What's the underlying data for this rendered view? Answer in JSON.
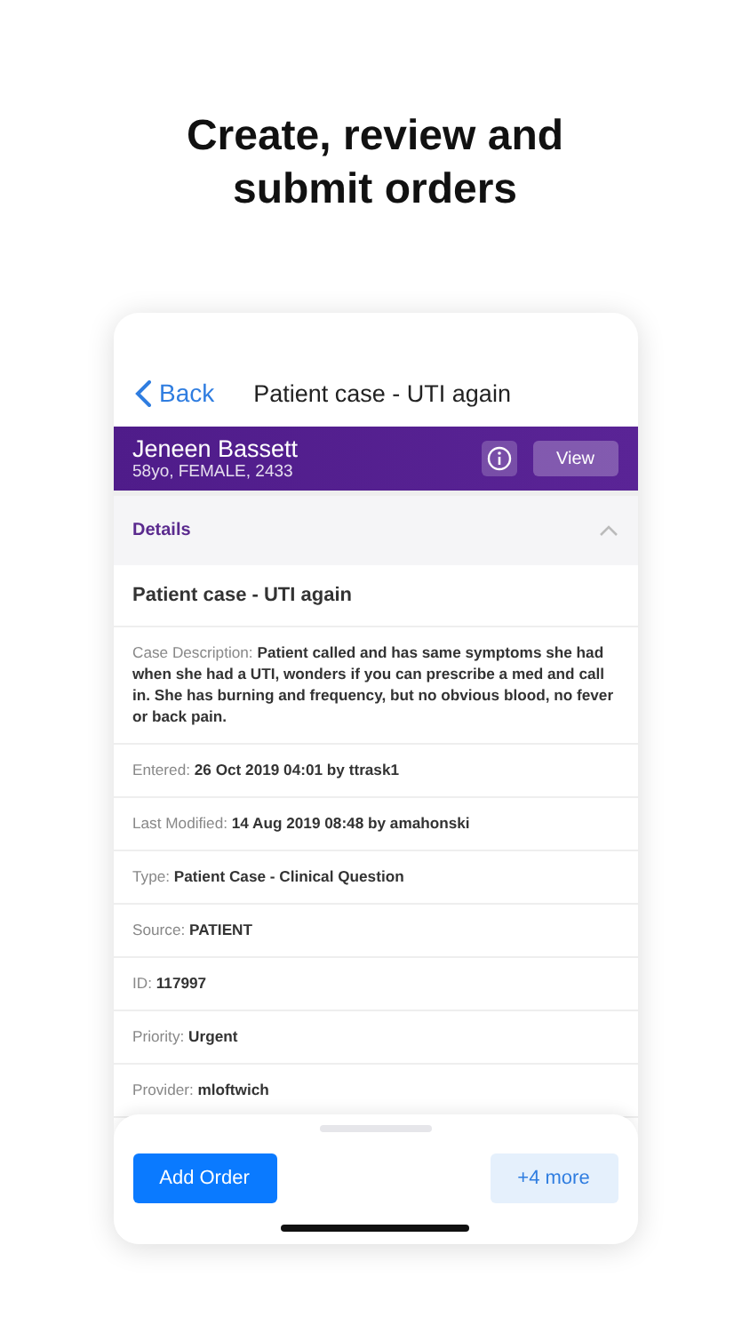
{
  "headline": "Create, review and submit orders",
  "nav": {
    "back": "Back",
    "title": "Patient case - UTI again"
  },
  "patient": {
    "name": "Jeneen Bassett",
    "details": "58yo, FEMALE, 2433",
    "view_button": "View"
  },
  "section": {
    "title": "Details",
    "expanded": true
  },
  "case_title": "Patient case - UTI again",
  "fields": [
    {
      "label": "Case Description:",
      "value": "Patient called and has same symptoms she had when she had a UTI, wonders if you can prescribe a med and call in.  She has burning and frequency, but no obvious blood, no fever or back pain."
    },
    {
      "label": "Entered:",
      "value": "26 Oct 2019 04:01 by ttrask1"
    },
    {
      "label": "Last Modified:",
      "value": "14 Aug 2019 08:48 by amahonski"
    },
    {
      "label": "Type:",
      "value": "Patient Case - Clinical Question"
    },
    {
      "label": "Source:",
      "value": "PATIENT"
    },
    {
      "label": "ID:",
      "value": "117997"
    },
    {
      "label": "Priority:",
      "value": "Urgent"
    },
    {
      "label": "Provider:",
      "value": "mloftwich"
    }
  ],
  "actions": {
    "primary": "Add Order",
    "more": "+4 more"
  }
}
